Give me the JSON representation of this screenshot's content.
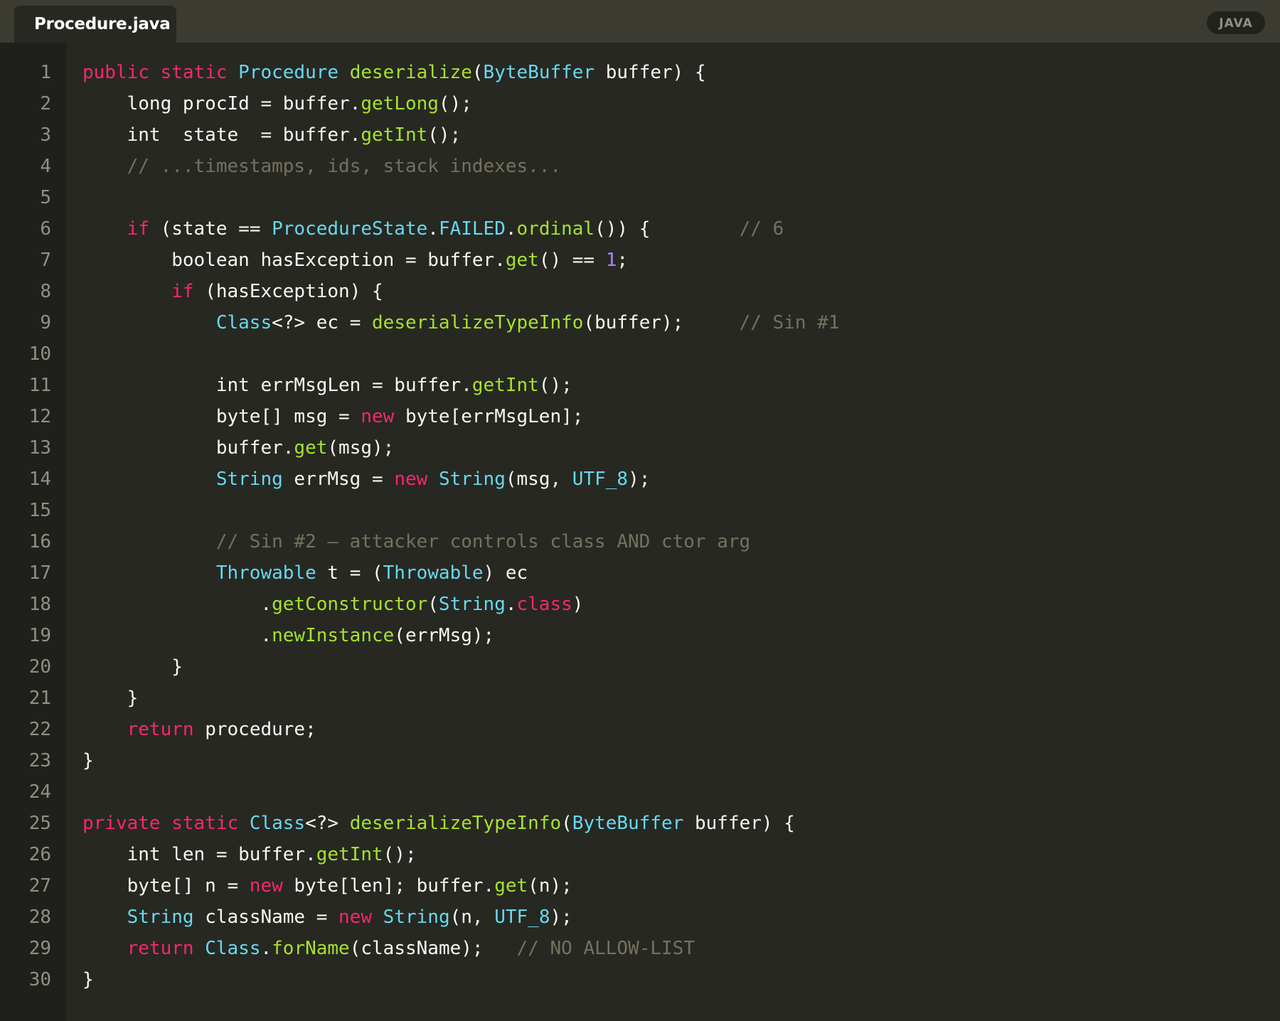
{
  "tab": {
    "filename": "Procedure.java"
  },
  "badge": {
    "language": "JAVA"
  },
  "colors": {
    "background": "#272822",
    "gutter": "#1f201b",
    "titlebar": "#3b3b32",
    "keyword": "#f92672",
    "type": "#66d9ef",
    "function": "#a6e22e",
    "number": "#ae81ff",
    "comment": "#75715e",
    "text": "#f8f8f2",
    "line_number": "#909084"
  },
  "code": {
    "lines": [
      {
        "n": "1",
        "tokens": [
          [
            "kw",
            "public"
          ],
          [
            "pl",
            " "
          ],
          [
            "kw",
            "static"
          ],
          [
            "pl",
            " "
          ],
          [
            "ty",
            "Procedure"
          ],
          [
            "pl",
            " "
          ],
          [
            "fn",
            "deserialize"
          ],
          [
            "pu",
            "("
          ],
          [
            "ty",
            "ByteBuffer"
          ],
          [
            "pl",
            " buffer"
          ],
          [
            "pu",
            ") {"
          ]
        ]
      },
      {
        "n": "2",
        "tokens": [
          [
            "pl",
            "    long procId = buffer"
          ],
          [
            "pu",
            "."
          ],
          [
            "fn",
            "getLong"
          ],
          [
            "pu",
            "();"
          ]
        ]
      },
      {
        "n": "3",
        "tokens": [
          [
            "pl",
            "    int  state  = buffer"
          ],
          [
            "pu",
            "."
          ],
          [
            "fn",
            "getInt"
          ],
          [
            "pu",
            "();"
          ]
        ]
      },
      {
        "n": "4",
        "tokens": [
          [
            "pl",
            "    "
          ],
          [
            "com",
            "// ...timestamps, ids, stack indexes..."
          ]
        ]
      },
      {
        "n": "5",
        "tokens": []
      },
      {
        "n": "6",
        "tokens": [
          [
            "pl",
            "    "
          ],
          [
            "kw",
            "if"
          ],
          [
            "pl",
            " (state == "
          ],
          [
            "ty",
            "ProcedureState"
          ],
          [
            "pu",
            "."
          ],
          [
            "ty",
            "FAILED"
          ],
          [
            "pu",
            "."
          ],
          [
            "fn",
            "ordinal"
          ],
          [
            "pu",
            "()) {"
          ],
          [
            "pl",
            "        "
          ],
          [
            "com",
            "// 6"
          ]
        ]
      },
      {
        "n": "7",
        "tokens": [
          [
            "pl",
            "        boolean hasException = buffer"
          ],
          [
            "pu",
            "."
          ],
          [
            "fn",
            "get"
          ],
          [
            "pu",
            "()"
          ],
          [
            "pl",
            " == "
          ],
          [
            "num",
            "1"
          ],
          [
            "pu",
            ";"
          ]
        ]
      },
      {
        "n": "8",
        "tokens": [
          [
            "pl",
            "        "
          ],
          [
            "kw",
            "if"
          ],
          [
            "pl",
            " (hasException) {"
          ]
        ]
      },
      {
        "n": "9",
        "tokens": [
          [
            "pl",
            "            "
          ],
          [
            "ty",
            "Class"
          ],
          [
            "pu",
            "<?>"
          ],
          [
            "pl",
            " ec = "
          ],
          [
            "fn",
            "deserializeTypeInfo"
          ],
          [
            "pu",
            "("
          ],
          [
            "pl",
            "buffer"
          ],
          [
            "pu",
            ");"
          ],
          [
            "pl",
            "     "
          ],
          [
            "com",
            "// Sin #1"
          ]
        ]
      },
      {
        "n": "10",
        "tokens": []
      },
      {
        "n": "11",
        "tokens": [
          [
            "pl",
            "            int errMsgLen = buffer"
          ],
          [
            "pu",
            "."
          ],
          [
            "fn",
            "getInt"
          ],
          [
            "pu",
            "();"
          ]
        ]
      },
      {
        "n": "12",
        "tokens": [
          [
            "pl",
            "            byte[] msg = "
          ],
          [
            "kw",
            "new"
          ],
          [
            "pl",
            " byte[errMsgLen];"
          ]
        ]
      },
      {
        "n": "13",
        "tokens": [
          [
            "pl",
            "            buffer"
          ],
          [
            "pu",
            "."
          ],
          [
            "fn",
            "get"
          ],
          [
            "pu",
            "("
          ],
          [
            "pl",
            "msg"
          ],
          [
            "pu",
            ");"
          ]
        ]
      },
      {
        "n": "14",
        "tokens": [
          [
            "pl",
            "            "
          ],
          [
            "ty",
            "String"
          ],
          [
            "pl",
            " errMsg = "
          ],
          [
            "kw",
            "new"
          ],
          [
            "pl",
            " "
          ],
          [
            "ty",
            "String"
          ],
          [
            "pu",
            "("
          ],
          [
            "pl",
            "msg, "
          ],
          [
            "ty",
            "UTF_8"
          ],
          [
            "pu",
            ");"
          ]
        ]
      },
      {
        "n": "15",
        "tokens": []
      },
      {
        "n": "16",
        "tokens": [
          [
            "pl",
            "            "
          ],
          [
            "com",
            "// Sin #2 — attacker controls class AND ctor arg"
          ]
        ]
      },
      {
        "n": "17",
        "tokens": [
          [
            "pl",
            "            "
          ],
          [
            "ty",
            "Throwable"
          ],
          [
            "pl",
            " t = ("
          ],
          [
            "ty",
            "Throwable"
          ],
          [
            "pl",
            ") ec"
          ]
        ]
      },
      {
        "n": "18",
        "tokens": [
          [
            "pl",
            "                "
          ],
          [
            "pu",
            "."
          ],
          [
            "fn",
            "getConstructor"
          ],
          [
            "pu",
            "("
          ],
          [
            "ty",
            "String"
          ],
          [
            "pu",
            "."
          ],
          [
            "kw",
            "class"
          ],
          [
            "pu",
            ")"
          ]
        ]
      },
      {
        "n": "19",
        "tokens": [
          [
            "pl",
            "                "
          ],
          [
            "pu",
            "."
          ],
          [
            "fn",
            "newInstance"
          ],
          [
            "pu",
            "("
          ],
          [
            "pl",
            "errMsg"
          ],
          [
            "pu",
            ");"
          ]
        ]
      },
      {
        "n": "20",
        "tokens": [
          [
            "pl",
            "        }"
          ]
        ]
      },
      {
        "n": "21",
        "tokens": [
          [
            "pl",
            "    }"
          ]
        ]
      },
      {
        "n": "22",
        "tokens": [
          [
            "pl",
            "    "
          ],
          [
            "kw",
            "return"
          ],
          [
            "pl",
            " procedure;"
          ]
        ]
      },
      {
        "n": "23",
        "tokens": [
          [
            "pl",
            "}"
          ]
        ]
      },
      {
        "n": "24",
        "tokens": []
      },
      {
        "n": "25",
        "tokens": [
          [
            "kw",
            "private"
          ],
          [
            "pl",
            " "
          ],
          [
            "kw",
            "static"
          ],
          [
            "pl",
            " "
          ],
          [
            "ty",
            "Class"
          ],
          [
            "pu",
            "<?>"
          ],
          [
            "pl",
            " "
          ],
          [
            "fn",
            "deserializeTypeInfo"
          ],
          [
            "pu",
            "("
          ],
          [
            "ty",
            "ByteBuffer"
          ],
          [
            "pl",
            " buffer"
          ],
          [
            "pu",
            ") {"
          ]
        ]
      },
      {
        "n": "26",
        "tokens": [
          [
            "pl",
            "    int len = buffer"
          ],
          [
            "pu",
            "."
          ],
          [
            "fn",
            "getInt"
          ],
          [
            "pu",
            "();"
          ]
        ]
      },
      {
        "n": "27",
        "tokens": [
          [
            "pl",
            "    byte[] n = "
          ],
          [
            "kw",
            "new"
          ],
          [
            "pl",
            " byte[len]; buffer"
          ],
          [
            "pu",
            "."
          ],
          [
            "fn",
            "get"
          ],
          [
            "pu",
            "("
          ],
          [
            "pl",
            "n"
          ],
          [
            "pu",
            ");"
          ]
        ]
      },
      {
        "n": "28",
        "tokens": [
          [
            "pl",
            "    "
          ],
          [
            "ty",
            "String"
          ],
          [
            "pl",
            " className = "
          ],
          [
            "kw",
            "new"
          ],
          [
            "pl",
            " "
          ],
          [
            "ty",
            "String"
          ],
          [
            "pu",
            "("
          ],
          [
            "pl",
            "n, "
          ],
          [
            "ty",
            "UTF_8"
          ],
          [
            "pu",
            ");"
          ]
        ]
      },
      {
        "n": "29",
        "tokens": [
          [
            "pl",
            "    "
          ],
          [
            "kw",
            "return"
          ],
          [
            "pl",
            " "
          ],
          [
            "ty",
            "Class"
          ],
          [
            "pu",
            "."
          ],
          [
            "fn",
            "forName"
          ],
          [
            "pu",
            "("
          ],
          [
            "pl",
            "className"
          ],
          [
            "pu",
            ");"
          ],
          [
            "pl",
            "   "
          ],
          [
            "com",
            "// NO ALLOW-LIST"
          ]
        ]
      },
      {
        "n": "30",
        "tokens": [
          [
            "pl",
            "}"
          ]
        ]
      }
    ]
  }
}
